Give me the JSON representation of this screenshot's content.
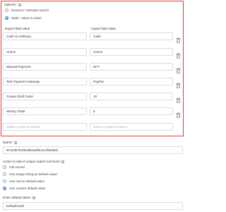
{
  "options": {
    "label": "Options",
    "required_mark": "*",
    "radio_dynamic": "Dynamic: NetSuite search",
    "radio_static": "Static: Value to value"
  },
  "mapping": {
    "export_header": "Export field value",
    "import_header": "Import field value",
    "rows": [
      {
        "export": "Cash on Delivery",
        "import": "Cash"
      },
      {
        "export": "Check",
        "import": "Check"
      },
      {
        "export": "Manual Payment",
        "import": "EFT"
      },
      {
        "export": "Test Payment Gateway",
        "import": "PayPal"
      },
      {
        "export": "Create Draft Order",
        "import": "10"
      },
      {
        "export": "Money Order",
        "import": "9"
      }
    ],
    "placeholder": "Select or type to search"
  },
  "name": {
    "label": "Name",
    "required_mark": "*",
    "value": "67103b7b2081db4aaf5c21cf55d8d1"
  },
  "no_match": {
    "label": "Action to take if unique match not found",
    "options": [
      "Fail record",
      "Use empty string as default value",
      "Use null as default value",
      "Use custom default value"
    ],
    "selected_index": 3
  },
  "default_value": {
    "label": "Enter default value",
    "required_mark": "*",
    "value": "DefaultCash"
  },
  "colors": {
    "highlight_border": "#e23b3b",
    "accent": "#2f6fd6",
    "required": "#e03030"
  }
}
